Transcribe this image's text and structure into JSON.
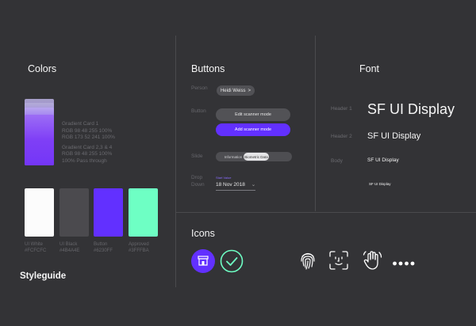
{
  "colors": {
    "title": "Colors",
    "gradient_text": [
      "Gradient Card 1",
      "RGB 98 48 255 100%",
      "RGB 173 52 241 100%",
      "",
      "Gradient Card 2,3 & 4",
      "RGB 98 48 255 100%",
      "100% Pass through"
    ],
    "swatches": [
      {
        "name": "UI White",
        "hex": "#FCFCFC",
        "color": "#fcfcfc"
      },
      {
        "name": "UI Black",
        "hex": "#4B4A4E",
        "color": "#4b4a4e"
      },
      {
        "name": "Button",
        "hex": "#6230FF",
        "color": "#6230ff"
      },
      {
        "name": "Approved",
        "hex": "#3FFFBA",
        "color": "#6effc4"
      }
    ]
  },
  "styleguide_label": "Styleguide",
  "buttons": {
    "title": "Buttons",
    "person_label": "Person",
    "person_chip": "Heidi Weiss",
    "person_chevron": ">",
    "button_label": "Button",
    "edit_button": "Edit scanner mode",
    "add_button": "Add scanner mode",
    "slide_label": "Slide",
    "slide_options": [
      "Information",
      "Biometric Data"
    ],
    "dropdown_label_1": "Drop",
    "dropdown_label_2": "Down",
    "dropdown_caption": "Start Value",
    "dropdown_value": "18 Nov 2018",
    "dropdown_chevron": "⌄"
  },
  "font": {
    "title": "Font",
    "rows": [
      {
        "label": "Header 1",
        "sample": "SF UI Display"
      },
      {
        "label": "Header 2",
        "sample": "SF UI Display"
      },
      {
        "label": "Body",
        "sample": "SF UI Display"
      },
      {
        "label": "",
        "sample": "SF UI Display"
      }
    ]
  },
  "icons": {
    "title": "Icons",
    "list": [
      "store-icon",
      "checkmark-circle-icon",
      "fingerprint-icon",
      "face-id-icon",
      "hand-wave-icon",
      "passcode-dots-icon"
    ],
    "accent": "#6230ff",
    "approved": "#6effc4"
  }
}
